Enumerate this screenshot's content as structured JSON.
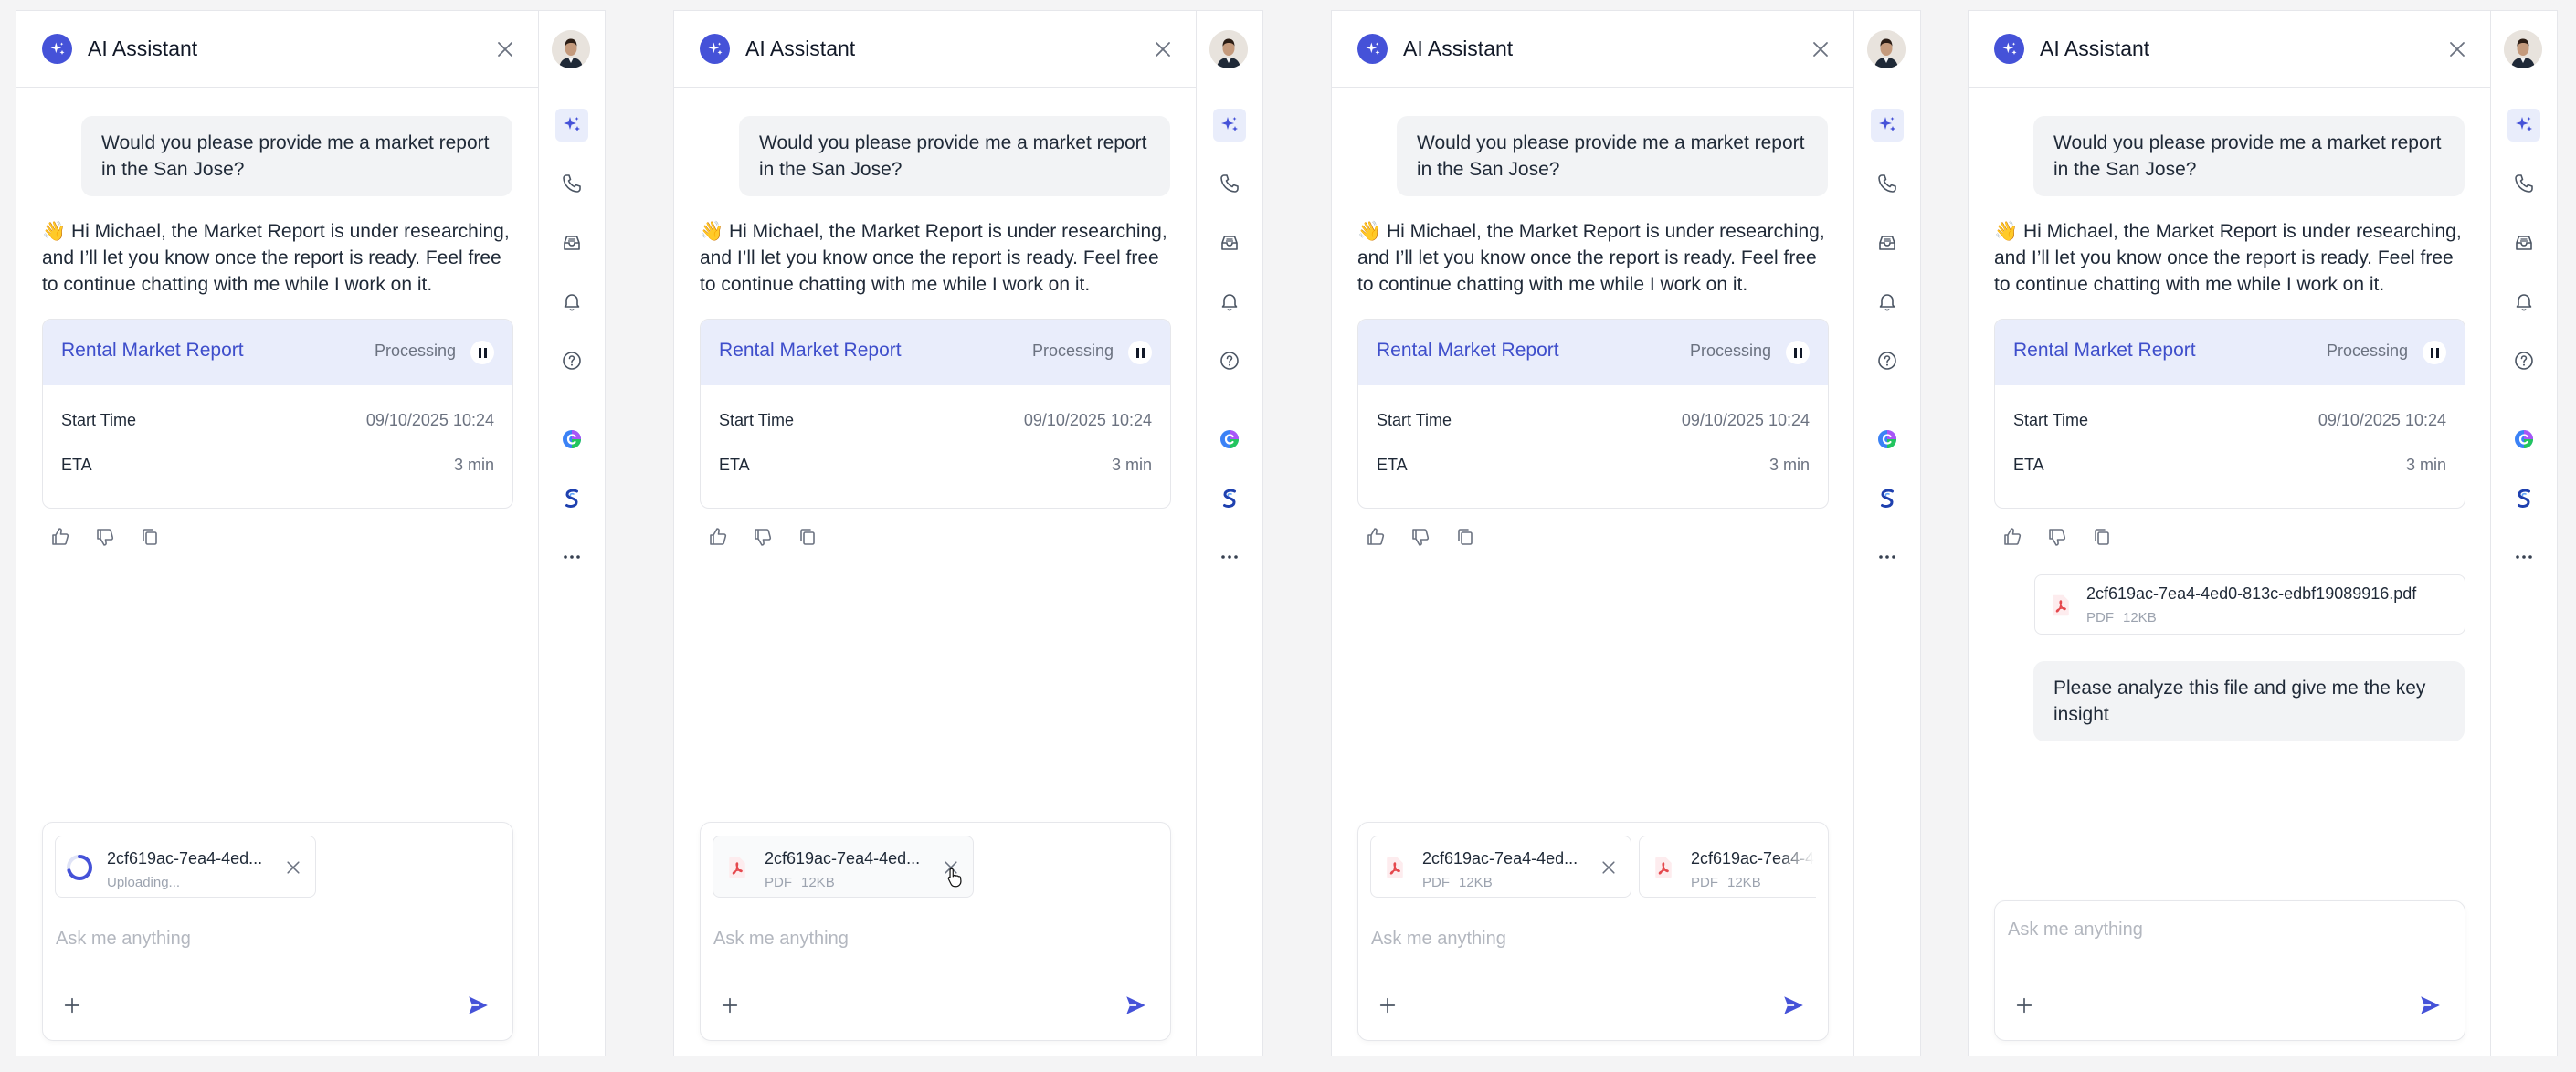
{
  "header": {
    "title": "AI Assistant"
  },
  "conversation": {
    "user_message": "Would you please provide me a market report in the San Jose?",
    "assistant_message": "👋 Hi Michael, the Market Report is under researching, and I’ll let you know once the report is ready. Feel free to continue chatting with me while I work on it."
  },
  "report_card": {
    "title": "Rental Market Report",
    "status": "Processing",
    "start_label": "Start Time",
    "start_value": "09/10/2025 10:24",
    "eta_label": "ETA",
    "eta_value": "3 min"
  },
  "composer": {
    "placeholder": "Ask me anything"
  },
  "attachment": {
    "name_truncated": "2cf619ac-7ea4-4ed...",
    "name_truncated_2": "2cf619ac-7ea4-4",
    "name_full": "2cf619ac-7ea4-4ed0-813c-edbf19089916.pdf",
    "type": "PDF",
    "size": "12KB",
    "uploading": "Uploading...",
    "upload_progress": 0.7
  },
  "followup_message": "Please analyze this file and give me the key insight",
  "rail_icons": [
    "sparkle-icon",
    "phone-icon",
    "inbox-icon",
    "bell-icon",
    "help-icon",
    "copilot-app-icon",
    "s-app-icon",
    "more-icon"
  ],
  "colors": {
    "accent": "#4552d8",
    "card_header_bg": "#e9edfb",
    "bubble_bg": "#f2f3f5",
    "pdf_red": "#e5484d"
  }
}
